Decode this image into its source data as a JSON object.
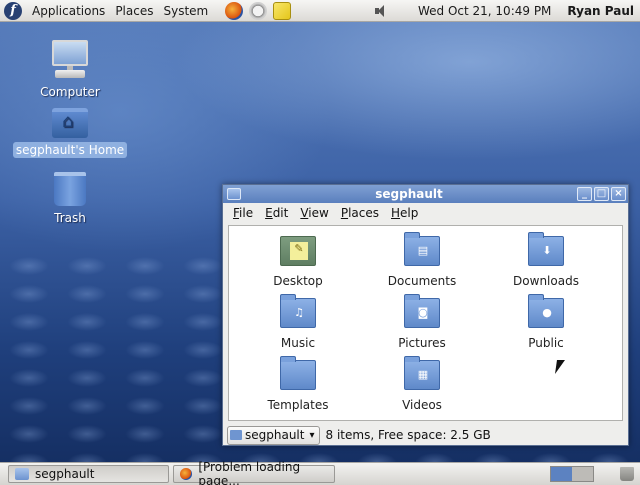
{
  "top_panel": {
    "menus": [
      "Applications",
      "Places",
      "System"
    ],
    "launchers": [
      "firefox-icon",
      "email-icon",
      "notes-icon"
    ],
    "clock": "Wed Oct 21, 10:49 PM",
    "user": "Ryan Paul"
  },
  "desktop_icons": [
    {
      "label": "Computer",
      "icon": "computer-icon"
    },
    {
      "label": "segphault's Home",
      "icon": "home-folder-icon",
      "selected": true
    },
    {
      "label": "Trash",
      "icon": "trash-icon"
    }
  ],
  "window": {
    "title": "segphault",
    "menu": [
      "File",
      "Edit",
      "View",
      "Places",
      "Help"
    ],
    "items": [
      {
        "label": "Desktop",
        "icon": "desktop-folder-icon"
      },
      {
        "label": "Documents",
        "icon": "documents-folder-icon"
      },
      {
        "label": "Downloads",
        "icon": "downloads-folder-icon"
      },
      {
        "label": "Music",
        "icon": "music-folder-icon"
      },
      {
        "label": "Pictures",
        "icon": "pictures-folder-icon"
      },
      {
        "label": "Public",
        "icon": "public-folder-icon"
      },
      {
        "label": "Templates",
        "icon": "templates-folder-icon"
      },
      {
        "label": "Videos",
        "icon": "videos-folder-icon"
      }
    ],
    "location": "segphault",
    "status": "8 items, Free space: 2.5 GB"
  },
  "bottom_panel": {
    "tasks": [
      {
        "label": "segphault",
        "active": true
      },
      {
        "label": "[Problem loading page..."
      }
    ]
  },
  "colors": {
    "titlebar": "#6b8fca",
    "selection": "#8fb0e0",
    "workspace_active": "#5c82c1"
  }
}
